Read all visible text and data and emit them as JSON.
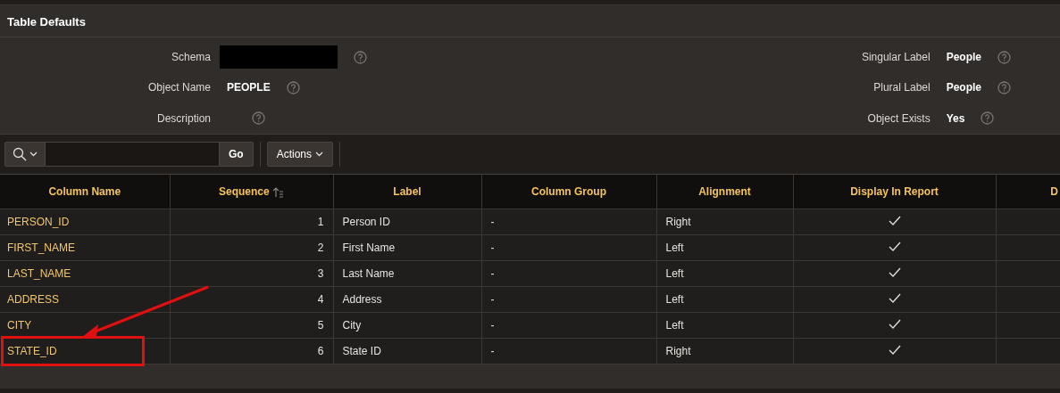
{
  "region": {
    "title": "Table Defaults"
  },
  "form": {
    "left": [
      {
        "label": "Schema",
        "kind": "redacted"
      },
      {
        "label": "Object Name",
        "kind": "text",
        "value": "PEOPLE"
      },
      {
        "label": "Description",
        "kind": "empty"
      }
    ],
    "right": [
      {
        "label": "Singular Label",
        "kind": "text",
        "value": "People"
      },
      {
        "label": "Plural Label",
        "kind": "text",
        "value": "People"
      },
      {
        "label": "Object Exists",
        "kind": "text",
        "value": "Yes"
      }
    ]
  },
  "toolbar": {
    "go": "Go",
    "actions": "Actions"
  },
  "table": {
    "columns": [
      {
        "label": "Column Name",
        "sorted": false
      },
      {
        "label": "Sequence",
        "sorted": true
      },
      {
        "label": "Label",
        "sorted": false
      },
      {
        "label": "Column Group",
        "sorted": false
      },
      {
        "label": "Alignment",
        "sorted": false
      },
      {
        "label": "Display In Report",
        "sorted": false
      },
      {
        "label": "D",
        "sorted": false
      }
    ],
    "rows": [
      {
        "column_name": "PERSON_ID",
        "sequence": "1",
        "label": "Person ID",
        "column_group": "-",
        "alignment": "Right",
        "display_in_report": true,
        "highlighted": false
      },
      {
        "column_name": "FIRST_NAME",
        "sequence": "2",
        "label": "First Name",
        "column_group": "-",
        "alignment": "Left",
        "display_in_report": true,
        "highlighted": false
      },
      {
        "column_name": "LAST_NAME",
        "sequence": "3",
        "label": "Last Name",
        "column_group": "-",
        "alignment": "Left",
        "display_in_report": true,
        "highlighted": false
      },
      {
        "column_name": "ADDRESS",
        "sequence": "4",
        "label": "Address",
        "column_group": "-",
        "alignment": "Left",
        "display_in_report": true,
        "highlighted": false
      },
      {
        "column_name": "CITY",
        "sequence": "5",
        "label": "City",
        "column_group": "-",
        "alignment": "Left",
        "display_in_report": true,
        "highlighted": false
      },
      {
        "column_name": "STATE_ID",
        "sequence": "6",
        "label": "State ID",
        "column_group": "-",
        "alignment": "Right",
        "display_in_report": true,
        "highlighted": true
      }
    ]
  }
}
